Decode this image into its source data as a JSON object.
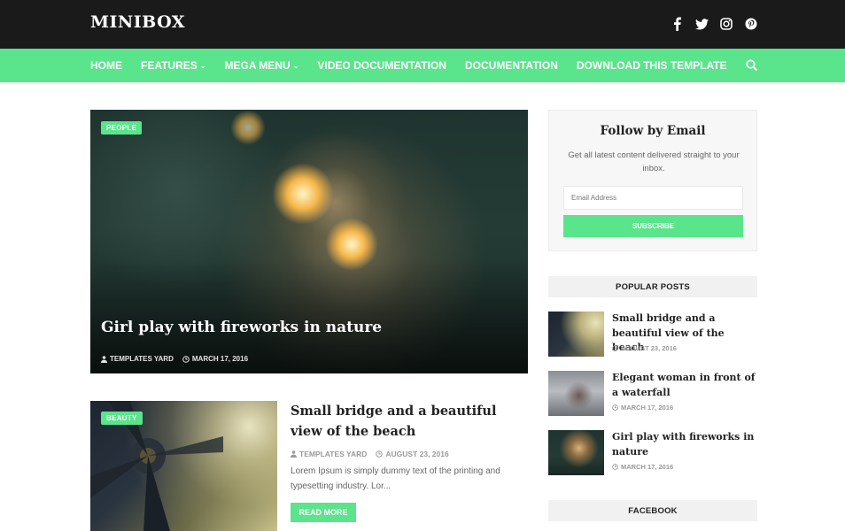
{
  "site": {
    "title": "MINIBOX"
  },
  "social": [
    "facebook-icon",
    "twitter-icon",
    "instagram-icon",
    "pinterest-icon"
  ],
  "colors": {
    "accent": "#5ae48b",
    "topbar": "#1a1a1a"
  },
  "nav": {
    "items": [
      {
        "label": "HOME",
        "dropdown": false
      },
      {
        "label": "FEATURES",
        "dropdown": true
      },
      {
        "label": "MEGA MENU",
        "dropdown": true
      },
      {
        "label": "VIDEO DOCUMENTATION",
        "dropdown": false
      },
      {
        "label": "DOCUMENTATION",
        "dropdown": false
      },
      {
        "label": "DOWNLOAD THIS TEMPLATE",
        "dropdown": false
      }
    ]
  },
  "featured": {
    "category": "PEOPLE",
    "title": "Girl play with fireworks in nature",
    "author": "TEMPLATES YARD",
    "date": "MARCH 17, 2016"
  },
  "post": {
    "category": "BEAUTY",
    "title": "Small bridge and a beautiful view of the beach",
    "author": "TEMPLATES YARD",
    "date": "AUGUST 23, 2016",
    "excerpt": "Lorem Ipsum is simply dummy text of the printing and typesetting industry. Lor...",
    "read_more": "READ MORE"
  },
  "follow": {
    "title": "Follow by Email",
    "description": "Get all latest content delivered straight to your inbox.",
    "email_placeholder": "Email Address",
    "subscribe_label": "SUBSCRIBE"
  },
  "popular": {
    "heading": "POPULAR POSTS",
    "items": [
      {
        "title": "Small bridge and a beautiful view of the beach",
        "date": "AUGUST 23, 2016"
      },
      {
        "title": "Elegant woman in front of a waterfall",
        "date": "MARCH 17, 2016"
      },
      {
        "title": "Girl play with fireworks in nature",
        "date": "MARCH 17, 2016"
      }
    ]
  },
  "facebook": {
    "heading": "FACEBOOK"
  }
}
